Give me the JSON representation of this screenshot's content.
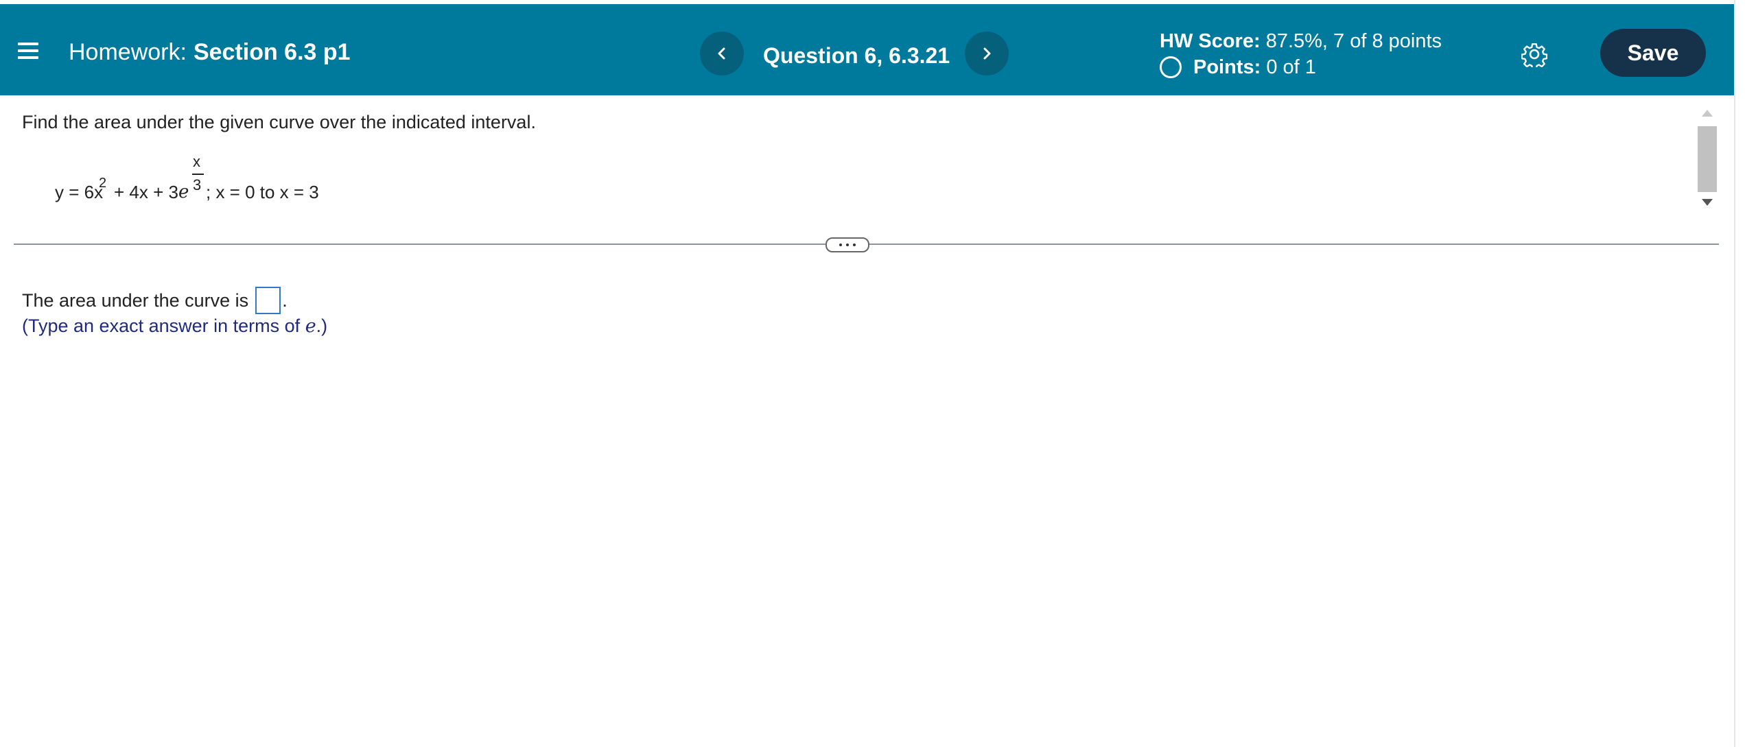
{
  "header": {
    "menu_icon": "hamburger-menu-icon",
    "homework_label": "Homework:",
    "section_title": "Section 6.3 p1",
    "prev_icon": "chevron-left-icon",
    "question_label": "Question 6, 6.3.21",
    "next_icon": "chevron-right-icon",
    "hw_score_label": "HW Score:",
    "hw_score_value": "87.5%, 7 of 8 points",
    "points_label": "Points:",
    "points_value": "0 of 1",
    "settings_icon": "gear-icon",
    "save_label": "Save",
    "colors": {
      "header_bg": "#007a9c",
      "nav_button_bg": "#05607c",
      "save_button_bg": "#16324a",
      "hint_text": "#1f2a80",
      "answer_box_border": "#3478c6"
    }
  },
  "question": {
    "prompt": "Find the area under the given curve over the indicated interval.",
    "equation": {
      "lhs": "y = 6x",
      "exp2": "2",
      "mid": "+ 4x + 3",
      "e": "e",
      "frac_num": "x",
      "frac_den": "3",
      "tail": "; x = 0 to x = 3"
    }
  },
  "answer": {
    "prefix": "The area under the curve is",
    "suffix": ".",
    "hint_start": "(Type an exact answer in terms of",
    "hint_e": "e",
    "hint_end": ".)"
  }
}
